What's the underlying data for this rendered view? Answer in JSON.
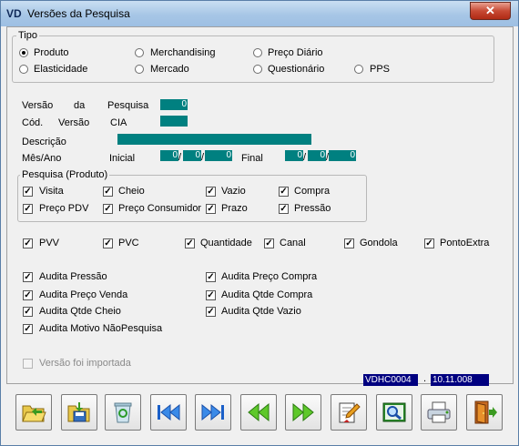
{
  "window": {
    "app_icon": "VD",
    "title": "Versões da Pesquisa",
    "close_glyph": "✕"
  },
  "tipo": {
    "legend": "Tipo",
    "options": [
      {
        "label": "Produto",
        "selected": true
      },
      {
        "label": "Merchandising",
        "selected": false
      },
      {
        "label": "Preço Diário",
        "selected": false
      },
      {
        "label": "Elasticidade",
        "selected": false
      },
      {
        "label": "Mercado",
        "selected": false
      },
      {
        "label": "Questionário",
        "selected": false
      },
      {
        "label": "PPS",
        "selected": false
      }
    ]
  },
  "form": {
    "versao_label": "Versão",
    "da_label": "da",
    "pesquisa_label": "Pesquisa",
    "versao_value": "0",
    "cod_label": "Cód.",
    "cod_versao_label": "Versão",
    "cia_label": "CIA",
    "cia_value": "",
    "descricao_label": "Descrição",
    "descricao_value": "",
    "mesano_label": "Mês/Ano",
    "inicial_label": "Inicial",
    "final_label": "Final",
    "inicial": {
      "d": "0",
      "m": "0",
      "y": "0"
    },
    "final": {
      "d": "0",
      "m": "0",
      "y": "0"
    },
    "sep": "/"
  },
  "pesquisa_produto": {
    "legend": "Pesquisa (Produto)",
    "items": [
      {
        "label": "Visita",
        "checked": true
      },
      {
        "label": "Cheio",
        "checked": true
      },
      {
        "label": "Vazio",
        "checked": true
      },
      {
        "label": "Compra",
        "checked": true
      },
      {
        "label": "Preço PDV",
        "checked": true
      },
      {
        "label": "Preço Consumidor",
        "checked": true
      },
      {
        "label": "Prazo",
        "checked": true
      },
      {
        "label": "Pressão",
        "checked": true
      }
    ]
  },
  "row_flags": [
    {
      "label": "PVV",
      "checked": true
    },
    {
      "label": "PVC",
      "checked": true
    },
    {
      "label": "Quantidade",
      "checked": true
    },
    {
      "label": "Canal",
      "checked": true
    },
    {
      "label": "Gondola",
      "checked": true
    },
    {
      "label": "PontoExtra",
      "checked": true
    }
  ],
  "audita": [
    {
      "label": "Audita Pressão",
      "checked": true
    },
    {
      "label": "Audita Preço Compra",
      "checked": true
    },
    {
      "label": "Audita Preço Venda",
      "checked": true
    },
    {
      "label": "Audita Qtde Compra",
      "checked": true
    },
    {
      "label": "Audita Qtde Cheio",
      "checked": true
    },
    {
      "label": "Audita Qtde Vazio",
      "checked": true
    },
    {
      "label": "Audita Motivo NãoPesquisa",
      "checked": true
    }
  ],
  "importada": {
    "label": "Versão foi importada",
    "checked": false
  },
  "status": {
    "code": "VDHC0004",
    "dot": ".",
    "version": "10.11.008"
  },
  "check_glyph": "✓",
  "toolbar": [
    {
      "icon": "folder-open-icon"
    },
    {
      "icon": "save-icon"
    },
    {
      "icon": "recycle-bin-icon"
    },
    {
      "icon": "first-record-icon"
    },
    {
      "icon": "last-record-icon"
    },
    {
      "icon": "previous-record-icon"
    },
    {
      "icon": "next-record-icon"
    },
    {
      "icon": "edit-notepad-icon"
    },
    {
      "icon": "preview-search-icon"
    },
    {
      "icon": "printer-icon"
    },
    {
      "icon": "exit-door-icon"
    }
  ]
}
